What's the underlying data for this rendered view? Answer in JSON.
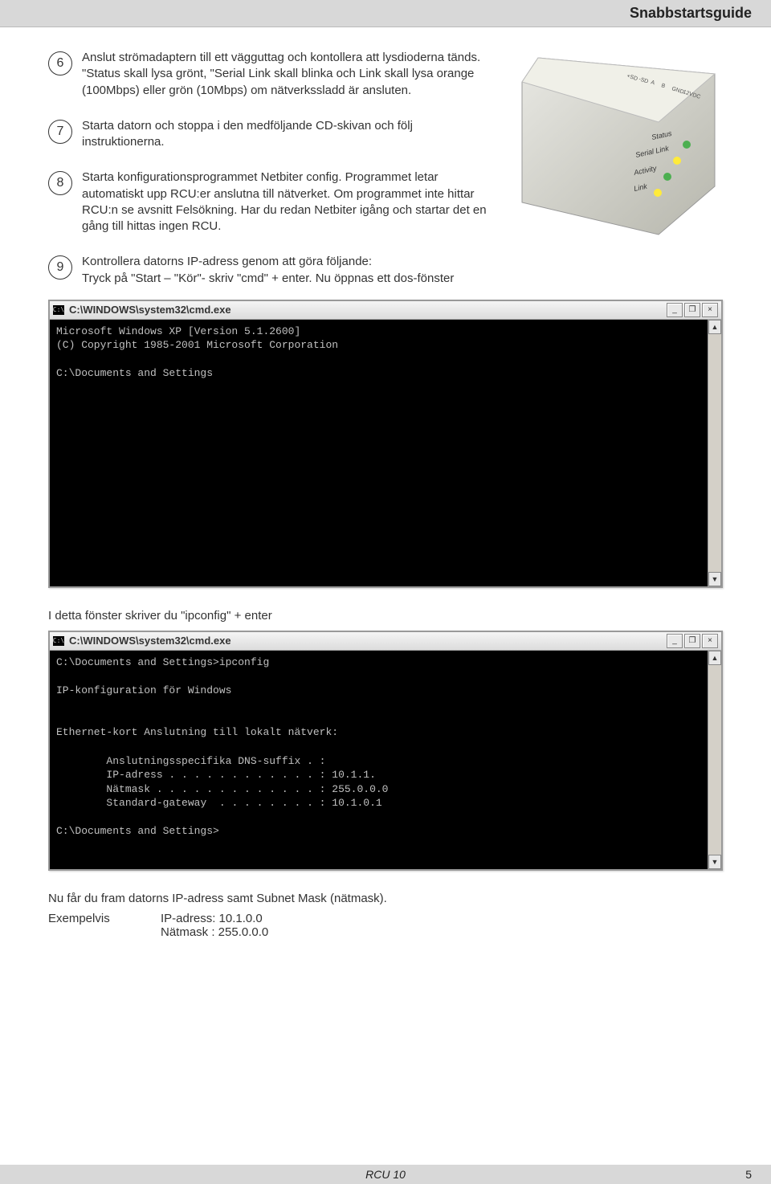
{
  "header": {
    "title": "Snabbstartsguide"
  },
  "steps": [
    {
      "num": "6",
      "text": "Anslut strömadaptern till  ett vägguttag och kontollera att lysdioderna tänds. \"Status skall lysa grönt, \"Serial Link skall blinka och Link skall lysa orange (100Mbps) eller grön (10Mbps) om nätverkssladd är ansluten."
    },
    {
      "num": "7",
      "text": "Starta datorn och stoppa i den medföljande CD-skivan och följ instruktionerna."
    },
    {
      "num": "8",
      "text": "Starta konfigurationsprogrammet Netbiter config. Programmet letar automatiskt upp RCU:er anslutna till nätverket. Om programmet inte hittar RCU:n se avsnitt Felsökning. Har du redan Netbiter igång och startar det en gång till hittas ingen RCU."
    },
    {
      "num": "9",
      "text": "Kontrollera datorns IP-adress genom att göra följande:",
      "sub": "Tryck på \"Start – \"Kör\"- skriv \"cmd\" + enter. Nu öppnas ett dos-fönster"
    }
  ],
  "device_labels": [
    "Status",
    "Serial Link",
    "Activity",
    "Link"
  ],
  "cmd1": {
    "title": "C:\\WINDOWS\\system32\\cmd.exe",
    "ico": "C:\\",
    "body": "Microsoft Windows XP [Version 5.1.2600]\n(C) Copyright 1985-2001 Microsoft Corporation\n\nC:\\Documents and Settings"
  },
  "mid_caption": "I detta fönster skriver du \"ipconfig\" + enter",
  "cmd2": {
    "title": "C:\\WINDOWS\\system32\\cmd.exe",
    "ico": "C:\\",
    "body": "C:\\Documents and Settings>ipconfig\n\nIP-konfiguration för Windows\n\n\nEthernet-kort Anslutning till lokalt nätverk:\n\n        Anslutningsspecifika DNS-suffix . :\n        IP-adress . . . . . . . . . . . . : 10.1.1.\n        Nätmask . . . . . . . . . . . . . : 255.0.0.0\n        Standard-gateway  . . . . . . . . : 10.1.0.1\n\nC:\\Documents and Settings>"
  },
  "after": {
    "l1": "Nu får du fram datorns IP-adress samt Subnet Mask (nätmask).",
    "ex_label": "Exempelvis",
    "ex_ip": "IP-adress: 10.1.0.0",
    "ex_mask": "Nätmask : 255.0.0.0"
  },
  "footer": {
    "doc": "RCU 10",
    "page": "5"
  },
  "winbtns": {
    "min": "_",
    "max": "❐",
    "close": "×"
  },
  "arrows": {
    "up": "▲",
    "down": "▼"
  }
}
